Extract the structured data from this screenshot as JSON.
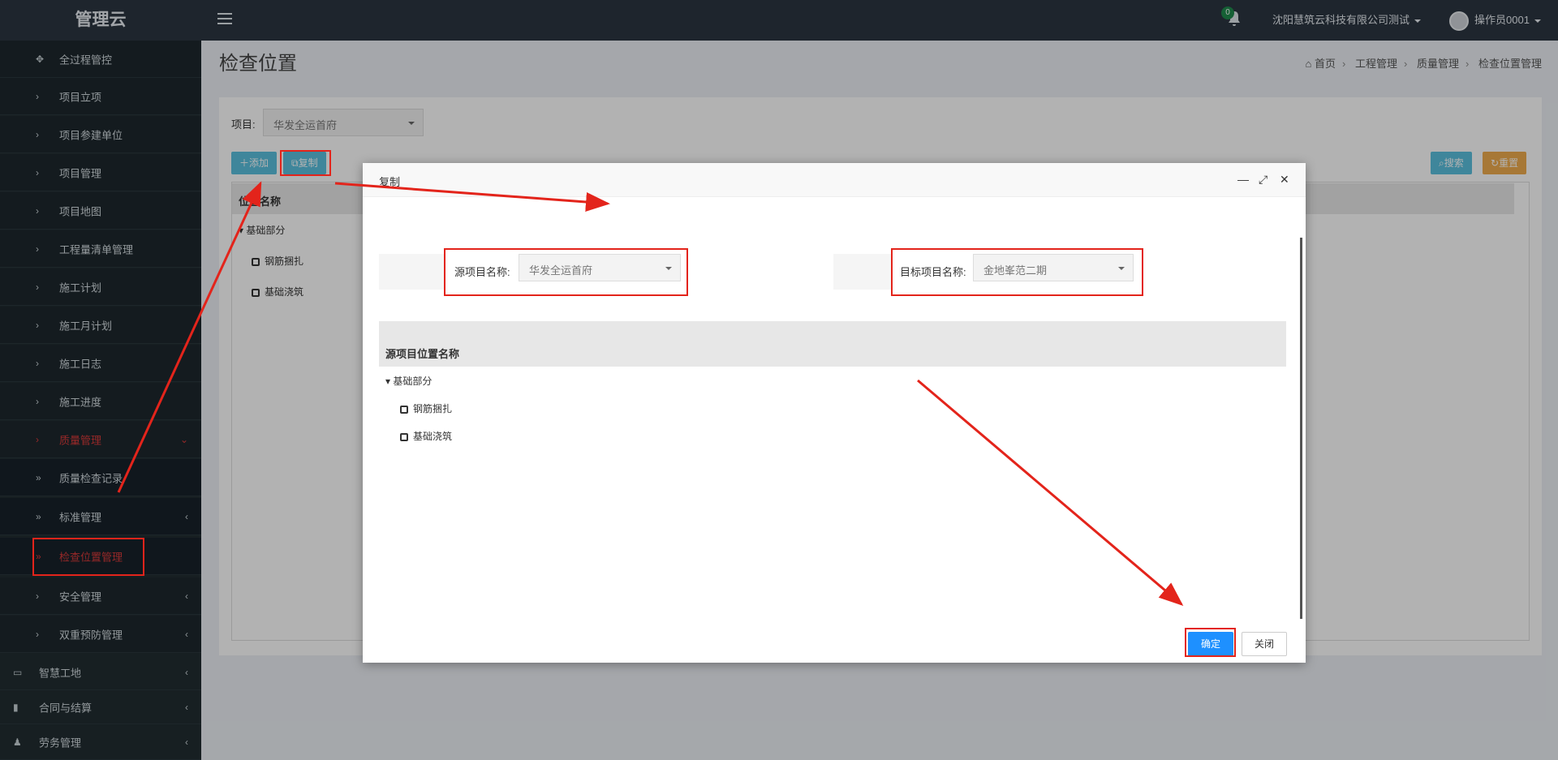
{
  "app": {
    "logo": "管理云"
  },
  "topbar": {
    "notification_count": "0",
    "company": "沈阳慧筑云科技有限公司测试",
    "operator": "操作员0001"
  },
  "sidebar": {
    "items": [
      {
        "label": "全过程管控"
      },
      {
        "label": "项目立项"
      },
      {
        "label": "项目参建单位"
      },
      {
        "label": "项目管理"
      },
      {
        "label": "项目地图"
      },
      {
        "label": "工程量清单管理"
      },
      {
        "label": "施工计划"
      },
      {
        "label": "施工月计划"
      },
      {
        "label": "施工日志"
      },
      {
        "label": "施工进度"
      },
      {
        "label": "质量管理"
      },
      {
        "label": "质量检查记录"
      },
      {
        "label": "标准管理"
      },
      {
        "label": "检查位置管理"
      },
      {
        "label": "安全管理"
      },
      {
        "label": "双重预防管理"
      },
      {
        "label": "智慧工地"
      },
      {
        "label": "合同与结算"
      },
      {
        "label": "劳务管理"
      }
    ]
  },
  "page": {
    "title": "检查位置",
    "breadcrumb": [
      "首页",
      "工程管理",
      "质量管理",
      "检查位置管理"
    ],
    "project_label": "项目:",
    "project_value": "华发全运首府",
    "buttons": {
      "add": "添加",
      "copy": "复制",
      "search": "搜索",
      "reset": "重置"
    },
    "table_header": "位置名称",
    "tree": {
      "root": "基础部分",
      "children": [
        "钢筋捆扎",
        "基础浇筑"
      ]
    }
  },
  "modal": {
    "title": "复制",
    "source_label": "源项目名称:",
    "source_value": "华发全运首府",
    "target_label": "目标项目名称:",
    "target_value": "金地峯范二期",
    "table_header": "源项目位置名称",
    "tree": {
      "root": "基础部分",
      "children": [
        "钢筋捆扎",
        "基础浇筑"
      ]
    },
    "ok": "确定",
    "close": "关闭"
  },
  "colors": {
    "highlight": "#e3241b",
    "primary": "#1e90ff",
    "info": "#5bc0de",
    "warning": "#f0ad4e",
    "sidebar": "#222d32"
  }
}
